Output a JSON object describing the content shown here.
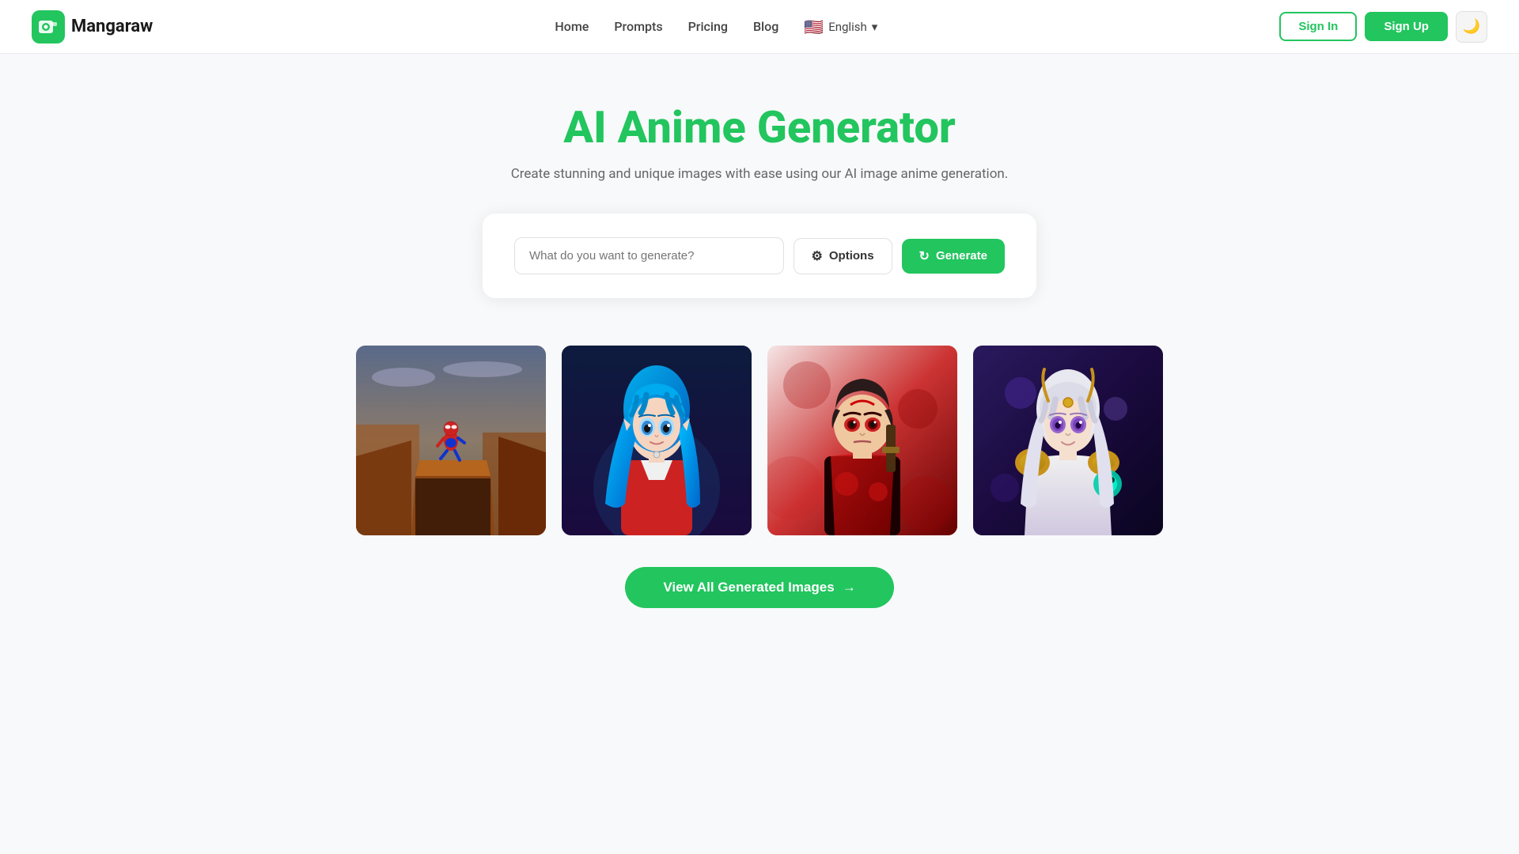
{
  "brand": {
    "logo_text": "Mangaraw",
    "logo_icon": "📷"
  },
  "nav": {
    "links": [
      {
        "label": "Home",
        "id": "home"
      },
      {
        "label": "Prompts",
        "id": "prompts"
      },
      {
        "label": "Pricing",
        "id": "pricing"
      },
      {
        "label": "Blog",
        "id": "blog"
      }
    ],
    "language": "English",
    "language_flag": "🇺🇸",
    "signin_label": "Sign In",
    "signup_label": "Sign Up",
    "theme_icon": "🌙"
  },
  "hero": {
    "title": "AI Anime Generator",
    "subtitle": "Create stunning and unique images with ease using our AI image anime generation."
  },
  "generator": {
    "placeholder": "What do you want to generate?",
    "options_label": "Options",
    "generate_label": "Generate"
  },
  "gallery": {
    "images": [
      {
        "id": 1,
        "alt": "Spider-Man on canyon cliff anime style"
      },
      {
        "id": 2,
        "alt": "Blue-haired anime elf girl in red coat"
      },
      {
        "id": 3,
        "alt": "Demon Slayer style warrior anime"
      },
      {
        "id": 4,
        "alt": "Fantasy white-haired female anime character"
      }
    ]
  },
  "view_all": {
    "label": "View All Generated Images",
    "arrow": "→"
  }
}
